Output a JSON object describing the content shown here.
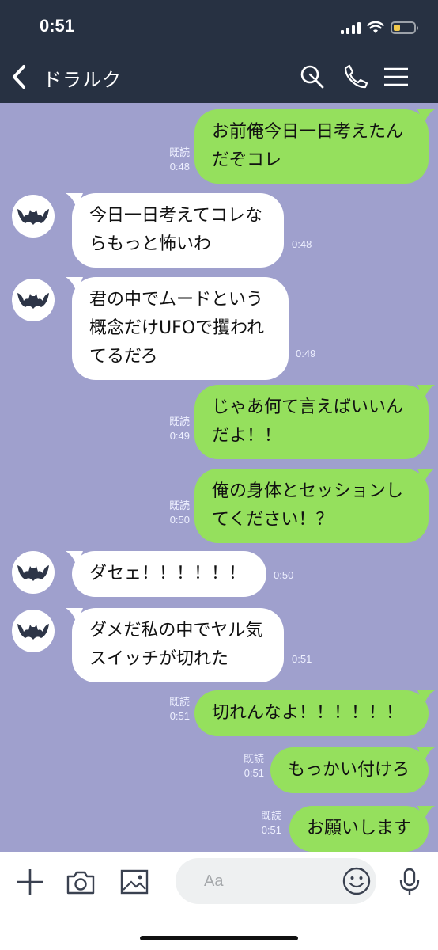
{
  "status_bar": {
    "time": "0:51",
    "battery_level": 0.35,
    "battery_color": "#f2c94c"
  },
  "header": {
    "title": "ドラルク",
    "back_icon": "chevron-left-icon",
    "search_icon": "search-icon",
    "call_icon": "phone-icon",
    "menu_icon": "menu-icon"
  },
  "colors": {
    "background": "#9fa0cd",
    "header": "#273142",
    "outgoing_bubble": "#95e05d",
    "incoming_bubble": "#ffffff"
  },
  "messages": [
    {
      "dir": "out",
      "lines": [
        "お前俺今日一日考えたん",
        "だぞコレ"
      ],
      "read": "既読",
      "time": "0:48"
    },
    {
      "dir": "in",
      "lines": [
        "今日一日考えてコレな",
        "らもっと怖いわ"
      ],
      "time": "0:48"
    },
    {
      "dir": "in",
      "lines": [
        "君の中でムードという",
        "概念だけUFOで攫われ",
        "てるだろ"
      ],
      "time": "0:49"
    },
    {
      "dir": "out",
      "lines": [
        "じゃあ何て言えばいいん",
        "だよ！！"
      ],
      "read": "既読",
      "time": "0:49"
    },
    {
      "dir": "out",
      "lines": [
        "俺の身体とセッションし",
        "てください！？"
      ],
      "read": "既読",
      "time": "0:50"
    },
    {
      "dir": "in",
      "lines": [
        "ダセェ！！！！！！"
      ],
      "time": "0:50"
    },
    {
      "dir": "in",
      "lines": [
        "ダメだ私の中でヤル気",
        "スイッチが切れた"
      ],
      "time": "0:51"
    },
    {
      "dir": "out",
      "lines": [
        "切れんなよ！！！！！！"
      ],
      "read": "既読",
      "time": "0:51"
    },
    {
      "dir": "out",
      "lines": [
        "もっかい付けろ"
      ],
      "read": "既読",
      "time": "0:51"
    },
    {
      "dir": "out",
      "lines": [
        "お願いします"
      ],
      "read": "既読",
      "time": "0:51"
    }
  ],
  "input_bar": {
    "placeholder": "Aa",
    "plus_icon": "plus-icon",
    "camera_icon": "camera-icon",
    "image_icon": "image-icon",
    "emoji_icon": "emoji-icon",
    "mic_icon": "microphone-icon"
  }
}
